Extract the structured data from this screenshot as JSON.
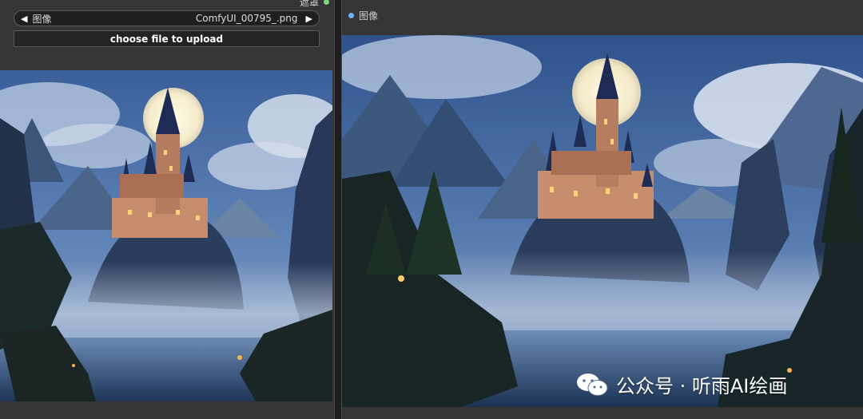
{
  "left_node": {
    "mask_output_label": "遮罩",
    "image_widget": {
      "label": "图像",
      "value": "ComfyUI_00795_.png",
      "prev_icon": "triangle-left",
      "next_icon": "triangle-right"
    },
    "upload_button": "choose file to upload"
  },
  "right_node": {
    "input_label": "图像",
    "watermark": {
      "icon": "wechat-icon",
      "text": "公众号 · 听雨AI绘画"
    }
  },
  "colors": {
    "node_bg": "#353535",
    "widget_bg": "#1f1f1f",
    "input_dot": "#6ab4f5",
    "output_dot": "#7bd87b"
  }
}
